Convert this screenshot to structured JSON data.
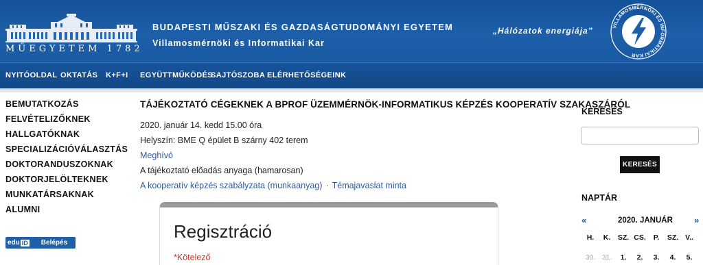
{
  "header": {
    "logo_text": "MŰEGYETEM 1782",
    "university": "BUDAPESTI MŰSZAKI ÉS GAZDASÁGTUDOMÁNYI EGYETEM",
    "faculty": "Villamosmérnöki és Informatikai Kar",
    "slogan": "„Hálózatok energiája”",
    "vik_ring_text": "VILLAMOSMÉRNÖKI ÉS INFORMATIKAI KAR",
    "vik_bottom_text": "BME",
    "colors": {
      "header_blue": "#1d5fa9",
      "nav_blue": "#134a8a"
    }
  },
  "nav": {
    "items": [
      {
        "label": "NYITÓOLDAL"
      },
      {
        "label": "OKTATÁS"
      },
      {
        "label": "K+F+I"
      },
      {
        "label": "EGYÜTTMŰKÖDÉS"
      },
      {
        "label": "SAJTÓSZOBA"
      },
      {
        "label": "ELÉRHETŐSÉGEINK"
      }
    ]
  },
  "sidebar": {
    "items": [
      {
        "label": "BEMUTATKOZÁS"
      },
      {
        "label": "FELVÉTELIZŐKNEK"
      },
      {
        "label": "HALLGATÓKNAK"
      },
      {
        "label": "SPECIALIZÁCIÓVÁLASZTÁS"
      },
      {
        "label": "DOKTORANDUSZOKNAK"
      },
      {
        "label": "DOKTORJELÖLTEKNEK"
      },
      {
        "label": "MUNKATÁRSAKNAK"
      },
      {
        "label": "ALUMNI"
      }
    ],
    "login": {
      "edu": "edu",
      "edu_i": "ID",
      "label": "Belépés",
      "icon": "eduid-icon"
    }
  },
  "main": {
    "title": "TÁJÉKOZTATÓ CÉGEKNEK A BPROF ÜZEMMÉRNÖK-INFORMATIKUS KÉPZÉS KOOPERATÍV SZAKASZÁRÓL",
    "date": "2020. január 14. kedd 15.00 óra",
    "location": "Helyszín: BME Q épület B szárny 402 terem",
    "invite_link": "Meghívó",
    "material": "A tájékoztató előadás anyaga (hamarosan)",
    "rules_link": "A kooperatív képzés szabályzata (munkaanyag)",
    "separator": "·",
    "topic_link": "Témajavaslat minta",
    "form": {
      "title": "Regisztráció",
      "required": "*Kötelező"
    }
  },
  "search": {
    "heading": "KERESÉS",
    "value": "",
    "button": "KERESÉS"
  },
  "calendar": {
    "heading": "NAPTÁR",
    "prev": "«",
    "next": "»",
    "month": "2020. JANUÁR",
    "weekdays": [
      "H.",
      "K.",
      "SZ.",
      "CS.",
      "P.",
      "SZ.",
      "V.."
    ],
    "first_row": [
      {
        "day": "30.",
        "muted": true
      },
      {
        "day": "31.",
        "muted": true
      },
      {
        "day": "1.",
        "muted": false
      },
      {
        "day": "2.",
        "muted": false
      },
      {
        "day": "3.",
        "muted": false
      },
      {
        "day": "4.",
        "muted": false
      },
      {
        "day": "5.",
        "muted": false
      }
    ]
  }
}
